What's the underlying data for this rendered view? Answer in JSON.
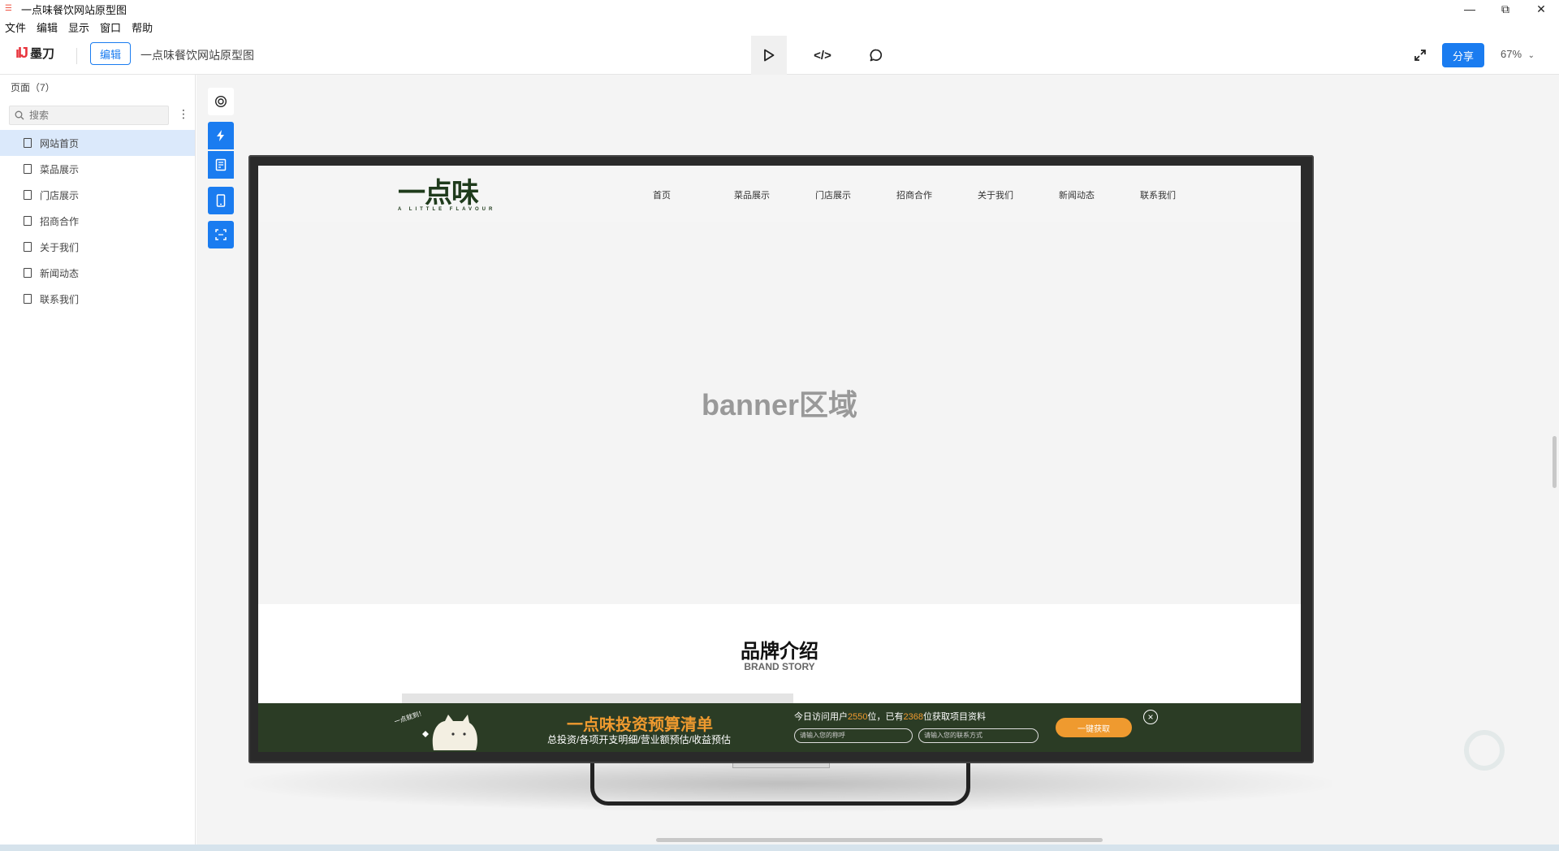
{
  "window": {
    "title": "一点味餐饮网站原型图",
    "controls": {
      "minimize": "—",
      "restore": "⧉",
      "close": "✕"
    }
  },
  "menubar": [
    "文件",
    "编辑",
    "显示",
    "窗口",
    "帮助"
  ],
  "toolbar": {
    "logo_text": "墨刀",
    "edit_label": "编辑",
    "doc_title": "一点味餐饮网站原型图",
    "code_label": "</>",
    "share_label": "分享",
    "zoom": "67%"
  },
  "sidebar": {
    "header": "页面（7）",
    "search_placeholder": "搜索",
    "pages": [
      {
        "label": "网站首页",
        "active": true
      },
      {
        "label": "菜品展示",
        "active": false
      },
      {
        "label": "门店展示",
        "active": false
      },
      {
        "label": "招商合作",
        "active": false
      },
      {
        "label": "关于我们",
        "active": false
      },
      {
        "label": "新闻动态",
        "active": false
      },
      {
        "label": "联系我们",
        "active": false
      }
    ]
  },
  "prototype": {
    "logo_cn": "一点味",
    "logo_en": "A LITTLE FLAVOUR",
    "nav": [
      "首页",
      "菜品展示",
      "门店展示",
      "招商合作",
      "关于我们",
      "新闻动态",
      "联系我们"
    ],
    "banner_label": "banner区域",
    "brand_title": "品牌介绍",
    "brand_subtitle": "BRAND STORY",
    "promo": {
      "title": "一点味投资预算清单",
      "subtitle": "总投资/各项开支明细/营业额预估/收益预估",
      "visit_prefix": "今日访问用户",
      "visit_count": "2550",
      "visit_mid": "位，已有",
      "got_count": "2368",
      "visit_suffix": "位获取项目资料",
      "input1_placeholder": "请输入您的称呼",
      "input2_placeholder": "请输入您的联系方式",
      "button_label": "一键获取",
      "cat_text": "一点就到！"
    }
  },
  "colors": {
    "accent": "#1a7cf0",
    "promo_bg": "#2b3c25",
    "promo_orange": "#ef9a2f",
    "logo_green": "#1f3b1c"
  }
}
